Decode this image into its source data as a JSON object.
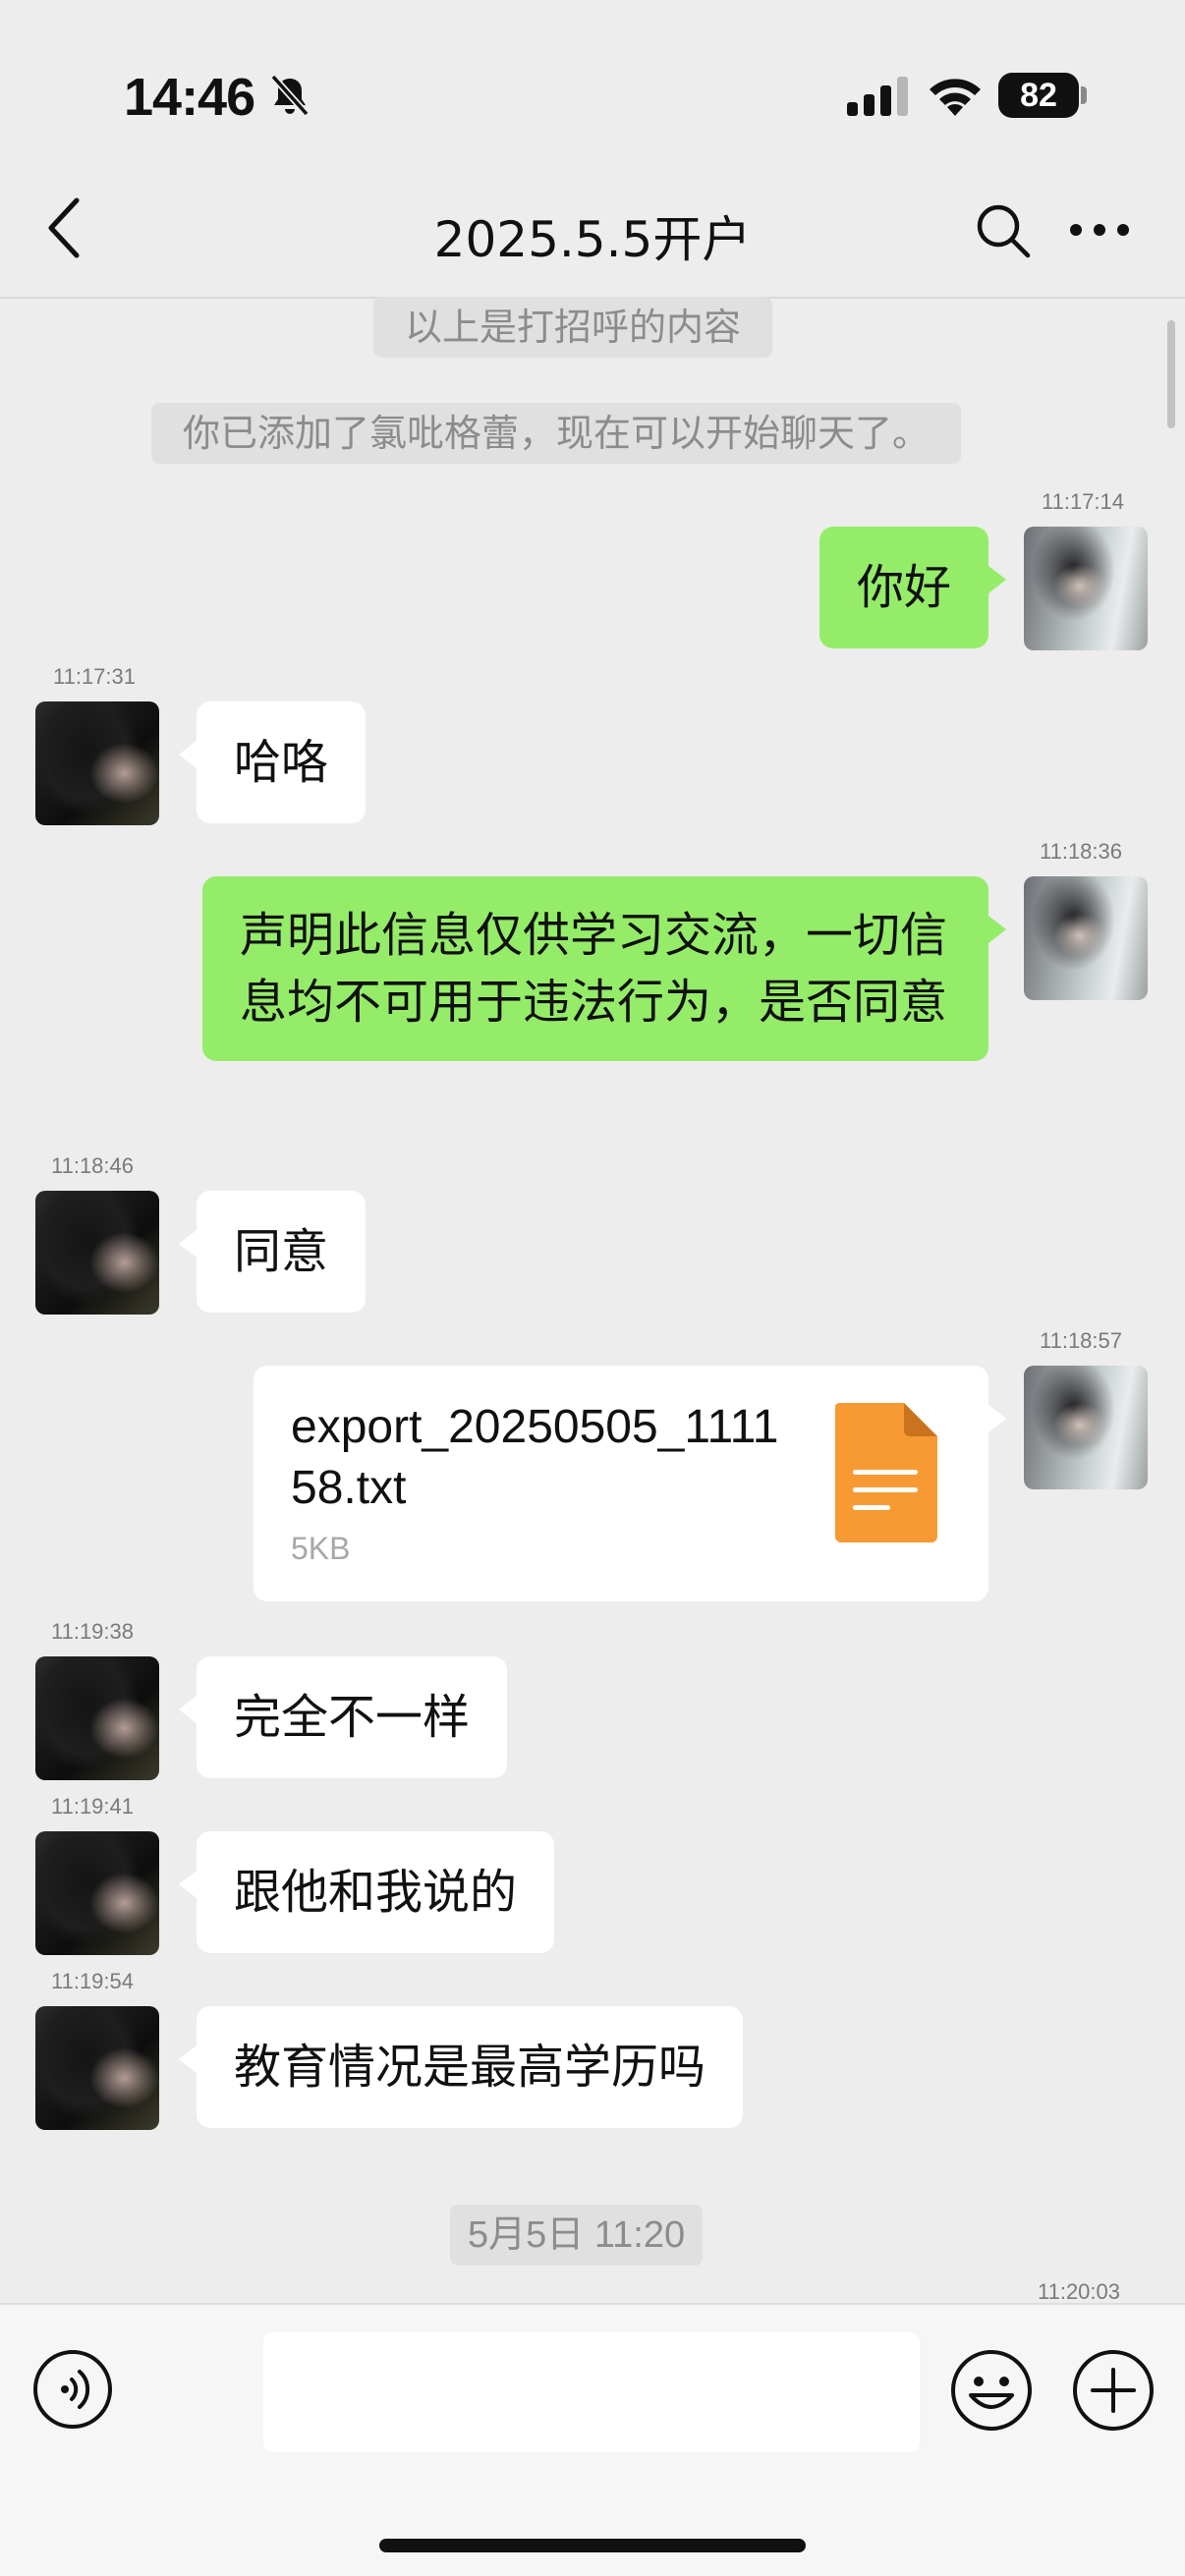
{
  "status_bar": {
    "time": "14:46",
    "battery": "82",
    "icons": [
      "bell-off-icon",
      "signal-icon",
      "wifi-icon",
      "battery-icon"
    ]
  },
  "nav": {
    "title": "2025.5.5开户",
    "icons": [
      "back-icon",
      "search-icon",
      "more-icon"
    ]
  },
  "system_messages": {
    "greeting_note": "以上是打招呼的内容",
    "added_friend": "你已添加了氯吡格蕾，现在可以开始聊天了。",
    "date_divider": "5月5日 11:20"
  },
  "messages": [
    {
      "time": "11:17:14",
      "direction": "out",
      "text": "你好"
    },
    {
      "time": "11:17:31",
      "direction": "in",
      "text": "哈咯"
    },
    {
      "time": "11:18:36",
      "direction": "out",
      "text": "声明此信息仅供学习交流，一切信息均不可用于违法行为，是否同意"
    },
    {
      "time": "11:18:46",
      "direction": "in",
      "text": "同意"
    },
    {
      "time": "11:18:57",
      "direction": "out",
      "type": "file",
      "file_name": "export_20250505_111158.txt",
      "file_size": "5KB"
    },
    {
      "time": "11:19:38",
      "direction": "in",
      "text": "完全不一样"
    },
    {
      "time": "11:19:41",
      "direction": "in",
      "text": "跟他和我说的"
    },
    {
      "time": "11:19:54",
      "direction": "in",
      "text": "教育情况是最高学历吗"
    }
  ],
  "trailing_time": "11:20:03",
  "input_bar": {
    "value": "",
    "icons": [
      "voice-icon",
      "emoji-icon",
      "plus-icon"
    ]
  },
  "colors": {
    "background": "#ededed",
    "outgoing_bubble": "#95ec69",
    "incoming_bubble": "#ffffff",
    "file_icon": "#f79a34"
  }
}
